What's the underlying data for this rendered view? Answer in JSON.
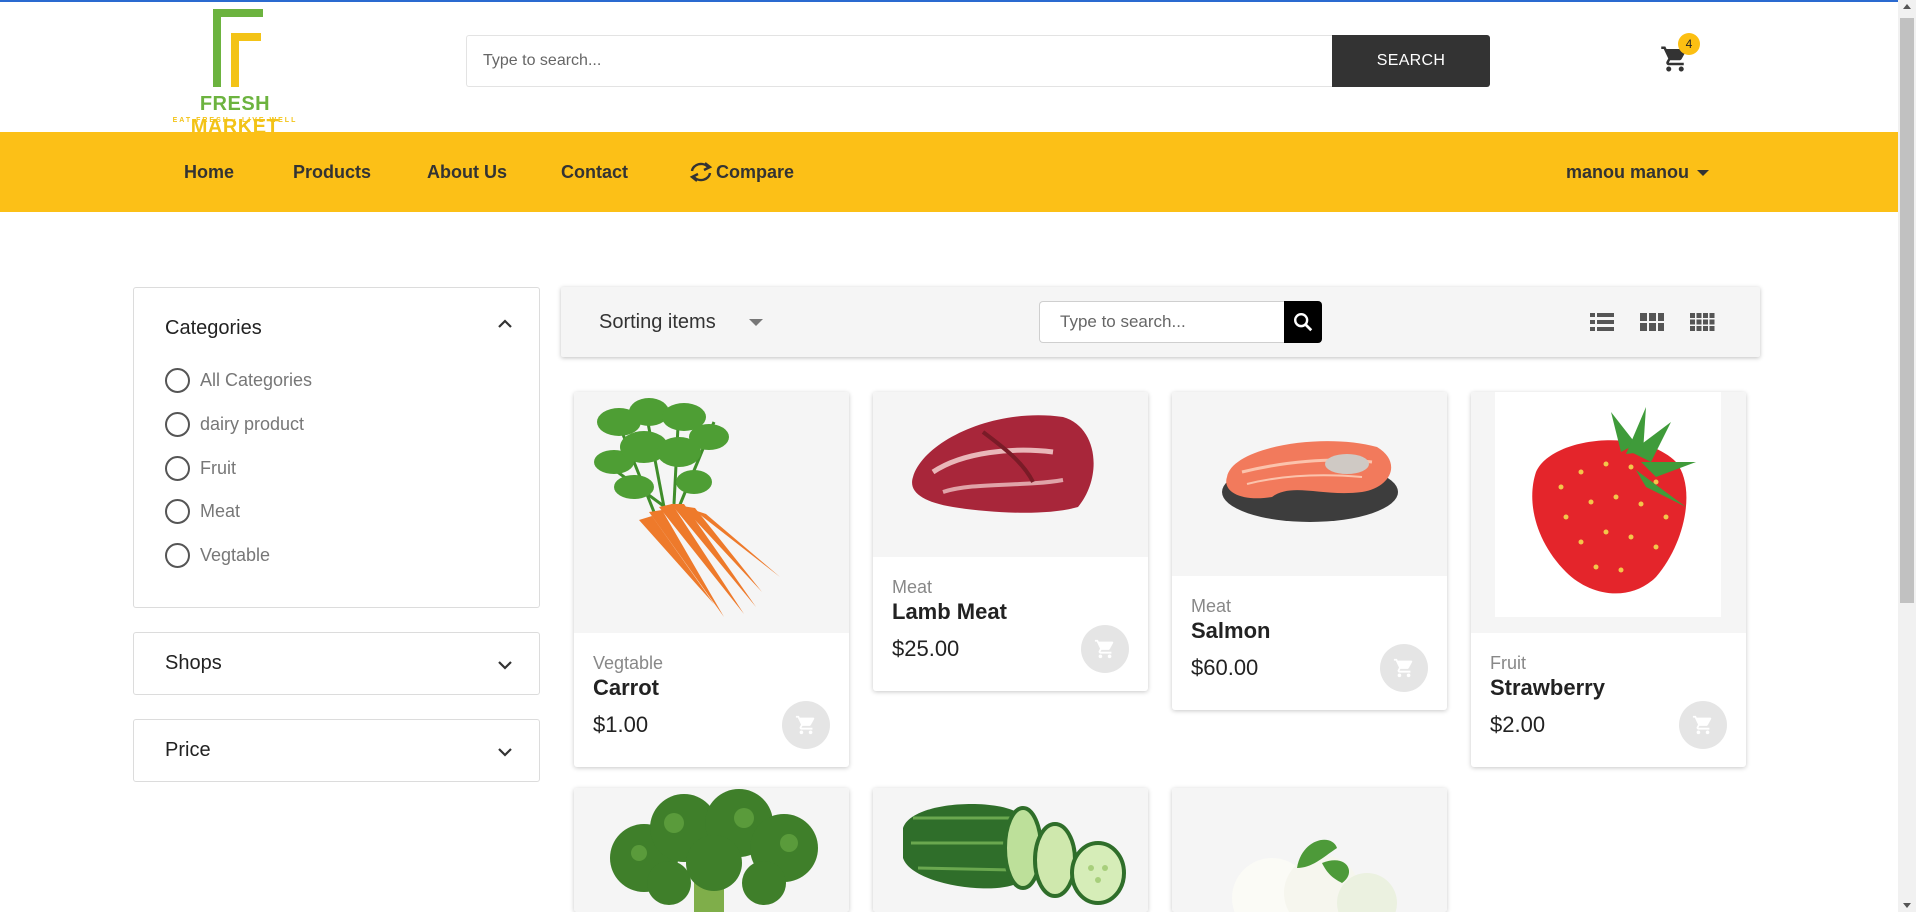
{
  "header": {
    "brand_part1": "FRESH",
    "brand_part2": "MARKET",
    "tagline": "EAT FRESH · LIVE WELL",
    "search_placeholder": "Type to search...",
    "search_button": "SEARCH",
    "cart_count": "4",
    "colors": {
      "accent": "#fcc017",
      "logo_green": "#6cb33f",
      "logo_yellow": "#f3c317",
      "dark": "#333333"
    }
  },
  "nav": {
    "items": [
      {
        "label": "Home",
        "icon": ""
      },
      {
        "label": "Products",
        "icon": ""
      },
      {
        "label": "About Us",
        "icon": ""
      },
      {
        "label": "Contact",
        "icon": ""
      },
      {
        "label": "Compare",
        "icon": "compare-arrows-icon"
      }
    ],
    "user_label": "manou manou"
  },
  "sidebar": {
    "categories_title": "Categories",
    "categories": [
      "All Categories",
      "dairy product",
      "Fruit",
      "Meat",
      "Vegtable"
    ],
    "shops_title": "Shops",
    "price_title": "Price"
  },
  "toolbar": {
    "sort_label": "Sorting items",
    "search_placeholder": "Type to search...",
    "views": [
      "list-view-icon",
      "grid-view-icon",
      "dense-grid-view-icon"
    ]
  },
  "products": [
    {
      "category": "Vegtable",
      "name": "Carrot",
      "price": "$1.00",
      "image": "carrot"
    },
    {
      "category": "Meat",
      "name": "Lamb Meat",
      "price": "$25.00",
      "image": "lamb-meat"
    },
    {
      "category": "Meat",
      "name": "Salmon",
      "price": "$60.00",
      "image": "salmon"
    },
    {
      "category": "Fruit",
      "name": "Strawberry",
      "price": "$2.00",
      "image": "strawberry"
    },
    {
      "image": "broccoli"
    },
    {
      "image": "cucumber"
    },
    {
      "image": "mozzarella"
    }
  ]
}
